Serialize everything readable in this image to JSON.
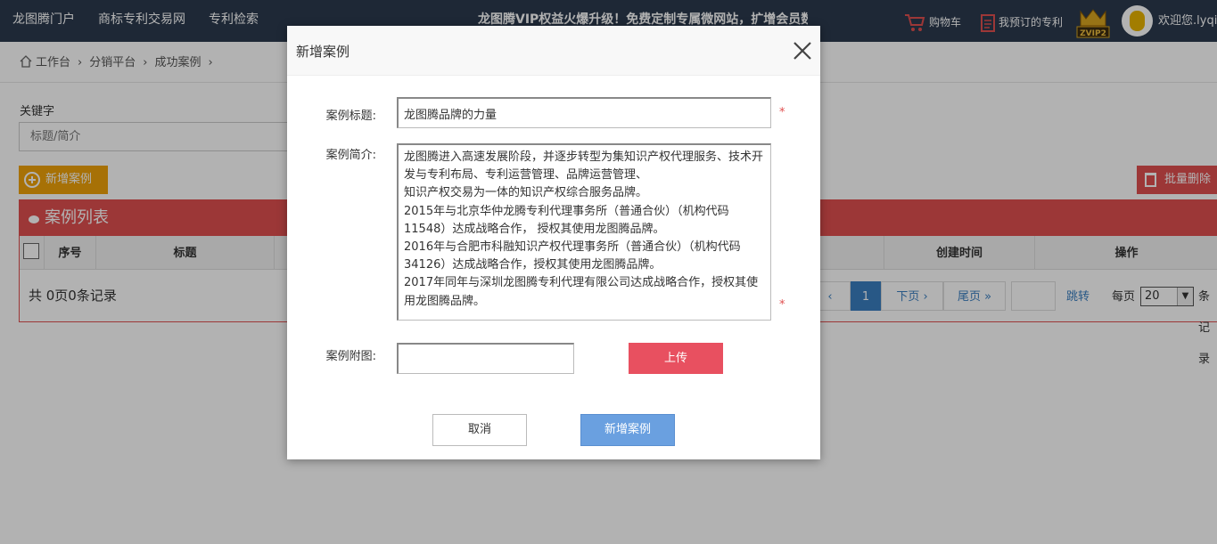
{
  "topnav": {
    "items": [
      "龙图腾门户",
      "商标专利交易网",
      "专利检索"
    ],
    "promo": "龙图腾VIP权益火爆升级！免费定制专属微网站，扩增会员数",
    "cart_label": "购物车",
    "subscribed_label": "我预订的专利",
    "vip_badge": "ZVIP2",
    "welcome": "欢迎您.lyqin"
  },
  "breadcrumb": [
    "工作台",
    "分销平台",
    "成功案例"
  ],
  "filter": {
    "keyword_label": "关键字",
    "keyword_placeholder": "标题/简介"
  },
  "toolbar": {
    "add_label": "新增案例",
    "batch_delete_label": "批量删除"
  },
  "panel": {
    "title": "案例列表",
    "columns": [
      "序号",
      "标题",
      "创建时间",
      "操作"
    ],
    "records_text": "共 0页0条记录",
    "pager": {
      "prev": "‹",
      "current": "1",
      "next": "下页 ›",
      "last": "尾页 »",
      "jump": "跳转",
      "per_page_label": "每页",
      "per_page_value": "20",
      "suffix": "条记录"
    }
  },
  "modal": {
    "title": "新增案例",
    "title_label": "案例标题:",
    "title_value": "龙图腾品牌的力量",
    "intro_label": "案例简介:",
    "intro_value": "龙图腾进入高速发展阶段，并逐步转型为集知识产权代理服务、技术开发与专利布局、专利运营管理、品牌运营管理、\n知识产权交易为一体的知识产权综合服务品牌。\n2015年与北京华仲龙腾专利代理事务所（普通合伙）（机构代码11548）达成战略合作， 授权其使用龙图腾品牌。\n2016年与合肥市科融知识产权代理事务所（普通合伙）（机构代码34126）达成战略合作，授权其使用龙图腾品牌。\n2017年同年与深圳龙图腾专利代理有限公司达成战略合作，授权其使用龙图腾品牌。",
    "attach_label": "案例附图:",
    "upload_label": "上传",
    "required_mark": "*",
    "cancel_label": "取消",
    "submit_label": "新增案例"
  },
  "colors": {
    "topbar": "#2b3a4e",
    "accent_red": "#e04f4f",
    "add_orange": "#f0a30a",
    "primary_blue": "#6aa0e0"
  }
}
